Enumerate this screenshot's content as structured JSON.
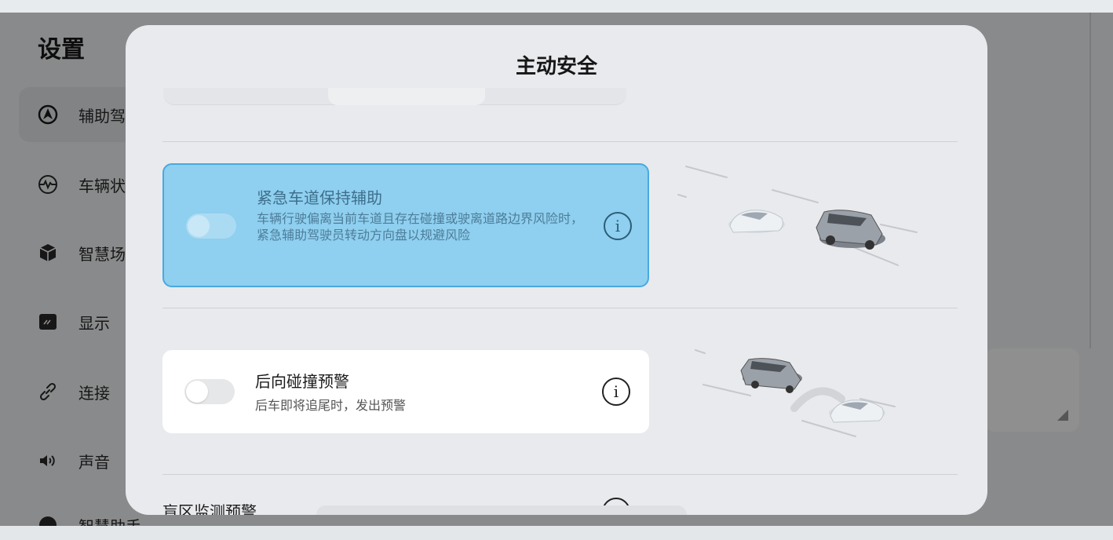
{
  "settings": {
    "title": "设置",
    "sidebar": [
      {
        "label": "辅助驾",
        "icon": "assist-drive-icon",
        "active": true
      },
      {
        "label": "车辆状",
        "icon": "vehicle-status-icon",
        "active": false
      },
      {
        "label": "智慧场",
        "icon": "cube-icon",
        "active": false
      },
      {
        "label": "显示",
        "icon": "display-icon",
        "active": false
      },
      {
        "label": "连接",
        "icon": "link-icon",
        "active": false
      },
      {
        "label": "声音",
        "icon": "speaker-icon",
        "active": false
      },
      {
        "label": "智慧助手",
        "icon": "assistant-icon",
        "active": false
      }
    ]
  },
  "modal": {
    "title": "主动安全",
    "rows": [
      {
        "title": "紧急车道保持辅助",
        "description": "车辆行驶偏离当前车道且存在碰撞或驶离道路边界风险时，紧急辅助驾驶员转动方向盘以规避风险",
        "toggle_on": false,
        "info_icon": "info-icon",
        "selected": true
      },
      {
        "title": "后向碰撞预警",
        "description": "后车即将追尾时，发出预警",
        "toggle_on": false,
        "info_icon": "info-icon",
        "selected": false
      },
      {
        "title": "盲区监测预警",
        "info_icon": "info-icon"
      }
    ],
    "info_glyph": "i"
  },
  "colors": {
    "selected_fill": "#8fcfef",
    "selected_border": "#49a9e0"
  }
}
